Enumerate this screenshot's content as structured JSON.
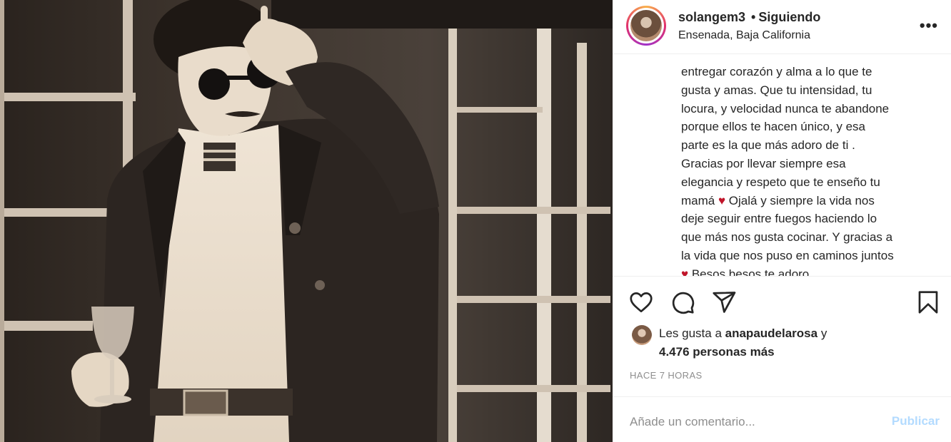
{
  "post": {
    "username": "solangem3",
    "separator": "•",
    "follow_status": "Siguiendo",
    "location": "Ensenada, Baja California",
    "more_icon": "more-horizontal-icon"
  },
  "caption": {
    "lines": [
      "entregar corazón y alma a lo que te",
      "gusta y amas. Que tu intensidad, tu",
      "locura, y velocidad nunca te abandone",
      "porque ellos te hacen único, y esa",
      "parte es la que más adoro de ti .",
      "Gracias por llevar siempre esa",
      "elegancia y respeto que te enseño tu",
      "mamá",
      "Ojalá y siempre la vida nos",
      "deje seguir entre fuegos haciendo lo",
      "que más nos gusta cocinar. Y gracias a",
      "la vida que nos puso en caminos juntos",
      "Besos besos te adoro"
    ],
    "heart_emoji": "♥"
  },
  "actions": {
    "like_icon": "heart-icon",
    "comment_icon": "comment-icon",
    "share_icon": "share-icon",
    "save_icon": "bookmark-icon"
  },
  "likes": {
    "prefix": "Les gusta a",
    "user": "anapaudelarosa",
    "suffix": "y",
    "others": "4.476 personas más"
  },
  "timestamp": "HACE 7 HORAS",
  "comment": {
    "placeholder": "Añade un comentario...",
    "publish_label": "Publicar"
  },
  "colors": {
    "accent_disabled": "#b3dbff",
    "heart": "#c0152a",
    "muted": "#8e8e8e"
  }
}
